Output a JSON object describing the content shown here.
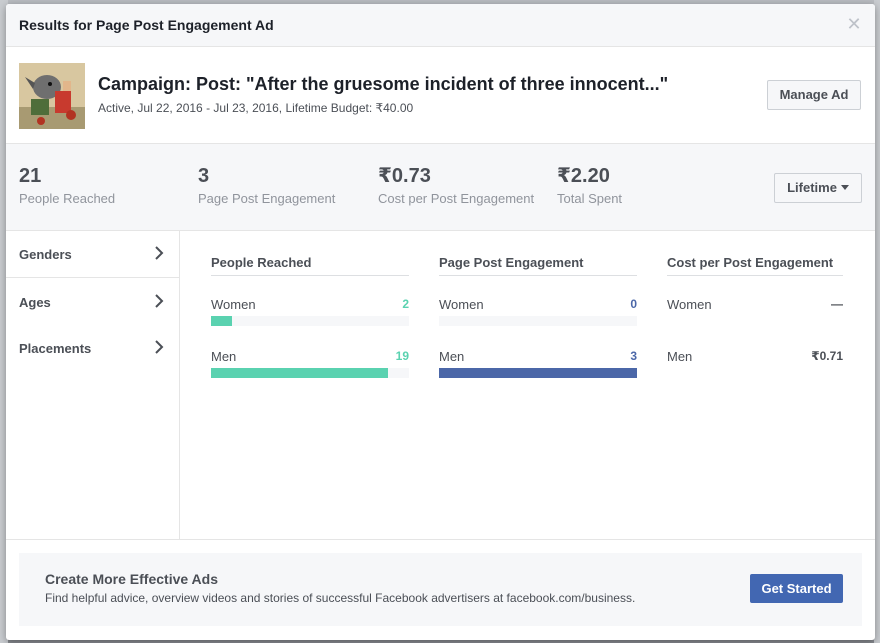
{
  "dialog": {
    "title": "Results for Page Post Engagement Ad"
  },
  "campaign": {
    "title": "Campaign: Post: \"After the gruesome incident of three innocent...\"",
    "meta": "Active, Jul 22, 2016 - Jul 23, 2016, Lifetime Budget: ₹40.00",
    "manage_label": "Manage Ad"
  },
  "stats": [
    {
      "value": "21",
      "label": "People Reached"
    },
    {
      "value": "3",
      "label": "Page Post Engagement"
    },
    {
      "value": "₹0.73",
      "label": "Cost per Post Engagement"
    },
    {
      "value": "₹2.20",
      "label": "Total Spent"
    }
  ],
  "range_selector": {
    "label": "Lifetime"
  },
  "sidebar": {
    "items": [
      {
        "label": "Genders"
      },
      {
        "label": "Ages"
      },
      {
        "label": "Placements"
      }
    ]
  },
  "breakdown": {
    "columns": [
      {
        "header": "People Reached",
        "rows": [
          {
            "label": "Women",
            "value": "2",
            "fraction": 0.105
          },
          {
            "label": "Men",
            "value": "19",
            "fraction": 0.895
          }
        ]
      },
      {
        "header": "Page Post Engagement",
        "rows": [
          {
            "label": "Women",
            "value": "0",
            "fraction": 0
          },
          {
            "label": "Men",
            "value": "3",
            "fraction": 1.0
          }
        ]
      },
      {
        "header": "Cost per Post Engagement",
        "rows": [
          {
            "label": "Women",
            "value": "—"
          },
          {
            "label": "Men",
            "value": "₹0.71"
          }
        ]
      }
    ]
  },
  "footer": {
    "title": "Create More Effective Ads",
    "text": "Find helpful advice, overview videos and stories of successful Facebook advertisers at facebook.com/business.",
    "cta_label": "Get Started"
  },
  "colors": {
    "reached": "#5ad2b0",
    "engagement": "#4b67a8",
    "primary_button": "#4267b2"
  }
}
